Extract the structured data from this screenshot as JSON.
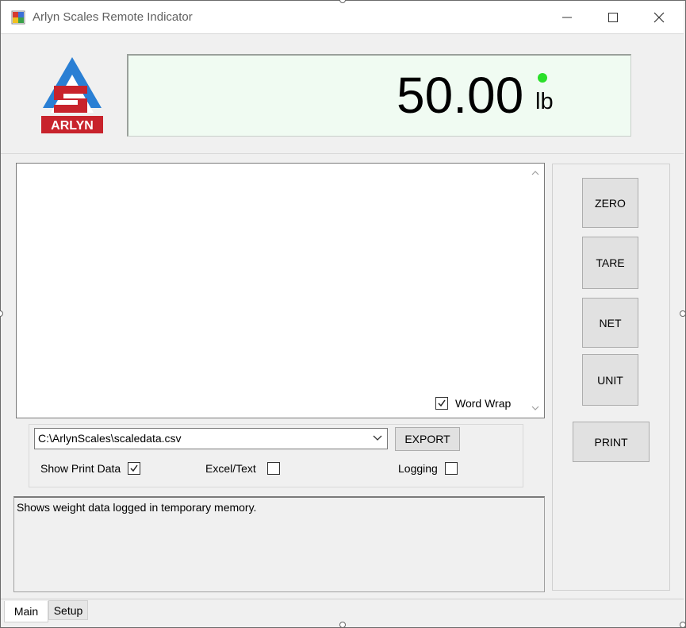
{
  "window": {
    "title": "Arlyn Scales Remote Indicator"
  },
  "logo": {
    "text": "ARLYN",
    "colors": {
      "blue": "#2a7fd4",
      "red": "#c8232c"
    }
  },
  "display": {
    "weight": "50.00",
    "unit": "lb",
    "led_color": "#2adf2a"
  },
  "log_area": {
    "word_wrap_label": "Word Wrap",
    "word_wrap_checked": true
  },
  "export": {
    "path": "C:\\ArlynScales\\scaledata.csv",
    "export_label": "EXPORT",
    "show_print_data_label": "Show Print Data",
    "show_print_data_checked": true,
    "excel_text_label": "Excel/Text",
    "excel_text_checked": false,
    "logging_label": "Logging",
    "logging_checked": false
  },
  "status": {
    "message": "Shows weight data logged in temporary memory."
  },
  "buttons": {
    "zero": "ZERO",
    "tare": "TARE",
    "net": "NET",
    "unit": "UNIT",
    "print": "PRINT"
  },
  "tabs": {
    "main": "Main",
    "setup": "Setup"
  }
}
